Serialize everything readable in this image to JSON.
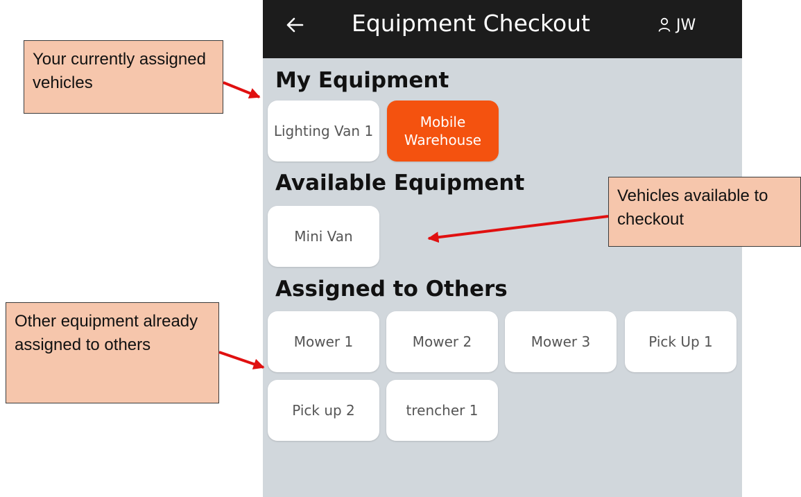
{
  "app": {
    "title": "Equipment Checkout",
    "user_initials": "JW"
  },
  "sections": {
    "my_equipment": {
      "heading": "My Equipment",
      "items": [
        "Lighting Van 1",
        "Mobile Warehouse"
      ],
      "selected": "Mobile Warehouse"
    },
    "available_equipment": {
      "heading": "Available Equipment",
      "items": [
        "Mini Van"
      ]
    },
    "assigned_to_others": {
      "heading": "Assigned to Others",
      "items": [
        "Mower 1",
        "Mower 2",
        "Mower 3",
        "Pick Up 1",
        "Pick up 2",
        "trencher 1"
      ]
    }
  },
  "annotations": {
    "my_equipment": "Your currently assigned vehicles",
    "available": "Vehicles available to checkout",
    "others": "Other equipment already assigned to others"
  },
  "colors": {
    "header_bg": "#1c1c1c",
    "app_bg": "#d1d7dc",
    "selected_tile": "#f4520f",
    "callout_fill": "#f6c6ac",
    "arrow": "#e01010"
  },
  "icons": {
    "back": "arrow-left-icon",
    "user": "user-icon"
  }
}
